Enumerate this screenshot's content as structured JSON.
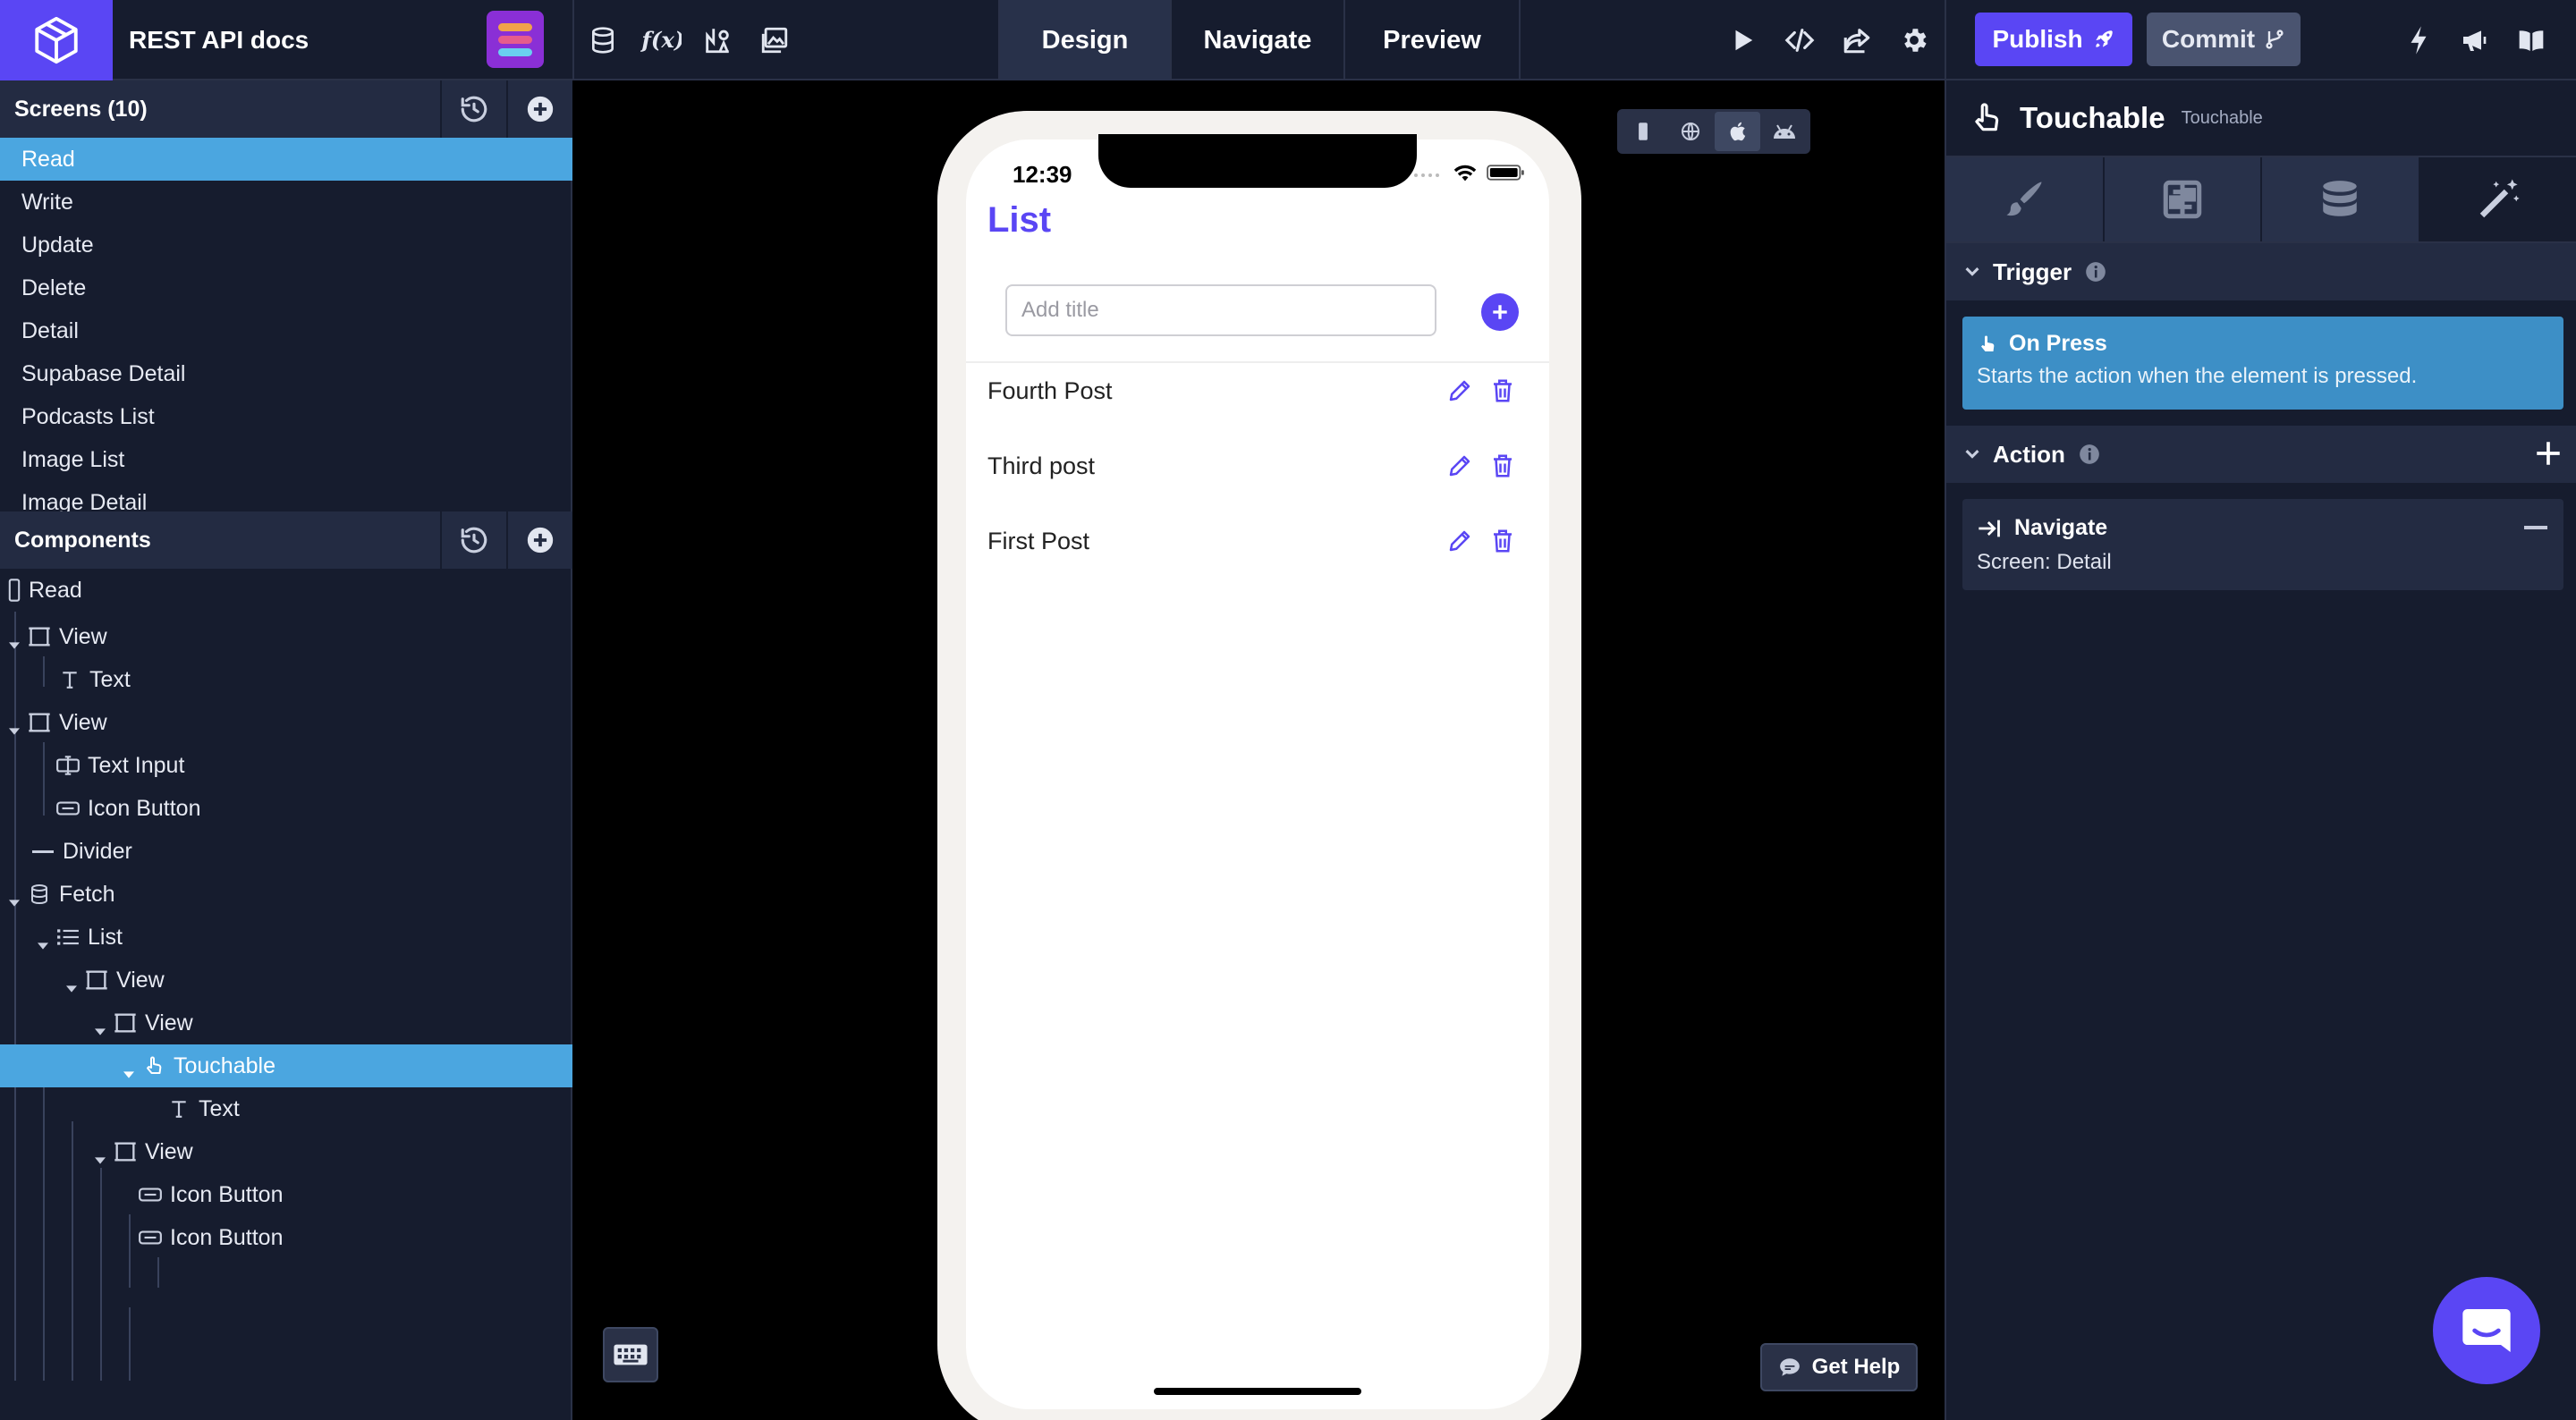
{
  "app": {
    "title": "REST API docs"
  },
  "toolbar": {
    "icons": [
      "database-icon",
      "formula-icon",
      "assets-icon",
      "media-icon"
    ],
    "modes": [
      "Design",
      "Navigate",
      "Preview"
    ],
    "active_mode": "Design",
    "right_icons": [
      "play-icon",
      "code-icon",
      "share-icon",
      "settings-icon"
    ],
    "publish_label": "Publish",
    "commit_label": "Commit",
    "far_right_icons": [
      "lightning-icon",
      "megaphone-icon",
      "book-icon"
    ]
  },
  "screens_panel": {
    "title": "Screens (10)",
    "items": [
      "Read",
      "Write",
      "Update",
      "Delete",
      "Detail",
      "Supabase Detail",
      "Podcasts List",
      "Image List",
      "Image Detail"
    ],
    "active": "Read"
  },
  "components_panel": {
    "title": "Components",
    "tree": [
      {
        "label": "Read",
        "icon": "screen-icon",
        "depth": 0
      },
      {
        "label": "View",
        "icon": "view-icon",
        "depth": 0
      },
      {
        "label": "Text",
        "icon": "text-icon",
        "depth": 1
      },
      {
        "label": "View",
        "icon": "view-icon",
        "depth": 0
      },
      {
        "label": "Text Input",
        "icon": "text-input-icon",
        "depth": 1
      },
      {
        "label": "Icon Button",
        "icon": "icon-button-icon",
        "depth": 1
      },
      {
        "label": "Divider",
        "icon": "divider-icon",
        "depth": 0
      },
      {
        "label": "Fetch",
        "icon": "fetch-icon",
        "depth": 0
      },
      {
        "label": "List",
        "icon": "list-icon",
        "depth": 1
      },
      {
        "label": "View",
        "icon": "view-icon",
        "depth": 2
      },
      {
        "label": "View",
        "icon": "view-icon",
        "depth": 3
      },
      {
        "label": "Touchable",
        "icon": "touchable-icon",
        "depth": 4
      },
      {
        "label": "Text",
        "icon": "text-icon",
        "depth": 5
      },
      {
        "label": "View",
        "icon": "view-icon",
        "depth": 3
      },
      {
        "label": "Icon Button",
        "icon": "icon-button-icon",
        "depth": 4
      },
      {
        "label": "Icon Button",
        "icon": "icon-button-icon",
        "depth": 4
      }
    ],
    "active": "Touchable"
  },
  "phone": {
    "time": "12:39",
    "title": "List",
    "input_placeholder": "Add title",
    "posts": [
      "Fourth Post",
      "Third post",
      "First Post"
    ]
  },
  "canvas": {
    "help_label": "Get Help",
    "device_options": [
      "mobile-icon",
      "web-icon",
      "apple-icon",
      "android-icon"
    ],
    "active_device": "apple-icon"
  },
  "inspector": {
    "title": "Touchable",
    "subtitle": "Touchable",
    "tabs": [
      "style-brush-icon",
      "layout-icon",
      "data-icon",
      "interactions-icon"
    ],
    "active_tab": "interactions-icon",
    "trigger": {
      "heading": "Trigger",
      "name": "On Press",
      "description": "Starts the action when the element is pressed."
    },
    "action": {
      "heading": "Action",
      "name": "Navigate",
      "detail": "Screen: Detail"
    }
  },
  "colors": {
    "accent": "#5a46f4",
    "panel_bg": "#161c2e",
    "selected": "#4ba6e0",
    "card_blue": "#3d8fc6"
  }
}
